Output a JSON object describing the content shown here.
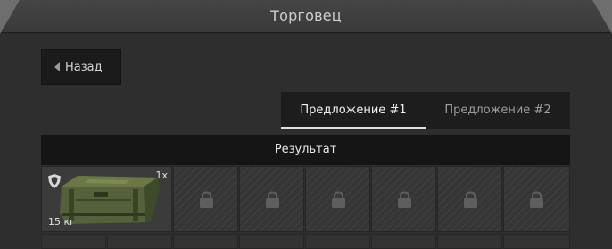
{
  "window": {
    "title": "Торговец"
  },
  "back_button": {
    "label": "Назад"
  },
  "tabs": [
    {
      "label": "Предложение #1",
      "active": true
    },
    {
      "label": "Предложение #2",
      "active": false
    }
  ],
  "result": {
    "header": "Результат",
    "item": {
      "name_icon": "military-crate-icon",
      "count": "1x",
      "weight": "15 кг",
      "badge_icon": "shield-icon"
    },
    "locked_slot_icon": "lock-icon"
  },
  "colors": {
    "background": "#2e2e2e",
    "titlebar": "#3f3f3f",
    "header": "#151515",
    "tab_active_underline": "#e0e0e0"
  }
}
